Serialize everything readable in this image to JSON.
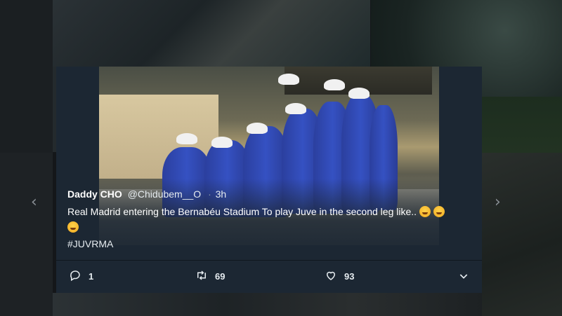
{
  "tweet": {
    "display_name": "Daddy CHO",
    "handle": "@Chidubem__O",
    "separator": "·",
    "time": "3h",
    "text": "Real Madrid entering the Bernabéu Stadium To play Juve in the second leg like..",
    "hashtag": "#JUVRMA"
  },
  "actions": {
    "reply_count": "1",
    "retweet_count": "69",
    "like_count": "93"
  },
  "icons": {
    "reply": "reply-icon",
    "retweet": "retweet-icon",
    "like": "heart-icon",
    "more": "chevron-down-icon",
    "emoji": "face-with-tears-of-joy-emoji"
  },
  "nav": {
    "prev": "‹",
    "next": "›"
  },
  "colors": {
    "card_background": "#1c2733",
    "page_background": "#14171a",
    "text": "#e6ecf0"
  }
}
